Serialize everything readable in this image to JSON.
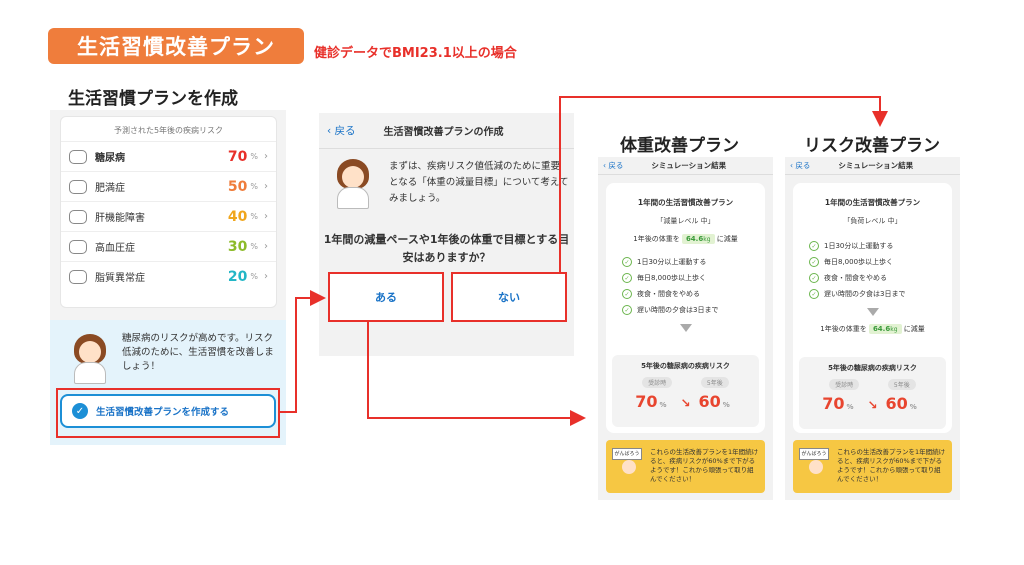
{
  "banner": {
    "title": "生活習慣改善プラン",
    "note": "健診データでBMI23.1以上の場合"
  },
  "panel1": {
    "heading": "生活習慣プランを作成",
    "risk_caption": "予測された5年後の疾病リスク",
    "risks": [
      {
        "name": "糖尿病",
        "value": "70",
        "unit": "%",
        "color": "#e8302a",
        "icon": "hand-icon"
      },
      {
        "name": "肥満症",
        "value": "50",
        "unit": "%",
        "color": "#ef7d3c",
        "icon": "scale-icon"
      },
      {
        "name": "肝機能障害",
        "value": "40",
        "unit": "%",
        "color": "#f0a61e",
        "icon": "liver-icon"
      },
      {
        "name": "高血圧症",
        "value": "30",
        "unit": "%",
        "color": "#8dbb2a",
        "icon": "drop-icon"
      },
      {
        "name": "脂質異常症",
        "value": "20",
        "unit": "%",
        "color": "#23b6c6",
        "icon": "vessel-icon"
      }
    ],
    "message": "糖尿病のリスクが高めです。リスク低減のために、生活習慣を改善しましょう！",
    "create_button": "生活習慣改善プランを作成する"
  },
  "panel2": {
    "back": "戻る",
    "title": "生活習慣改善プランの作成",
    "message": "まずは、疾病リスク値低減のために重要となる「体重の減量目標」について考えてみましょう。",
    "question": "1年間の減量ペースや1年後の体重で目標とする目安はありますか？",
    "yes": "ある",
    "no": "ない"
  },
  "weight_plan": {
    "heading": "体重改善プラン",
    "back": "戻る",
    "header_title": "シミュレーション結果",
    "card_title": "1年間の生活習慣改善プラン",
    "level": "「減量レベル 中」",
    "weight_prefix": "1年後の体重を",
    "weight_value": "64.6",
    "weight_unit": "kg",
    "weight_suffix": "に減量",
    "goals": [
      "1日30分以上運動する",
      "毎日8,000歩以上歩く",
      "夜食・間食をやめる",
      "遅い時間の夕食は3日まで"
    ],
    "risk_title": "5年後の糖尿病の疾病リスク",
    "tag_before": "受診時",
    "tag_after": "5年後",
    "before": "70",
    "after": "60",
    "unit": "%",
    "encourage": "これらの生活改善プランを1年間続けると、疾病リスクが60%まで下がるようです！これから頑張って取り組んでください！",
    "flag_text": "がんばろう"
  },
  "risk_plan": {
    "heading": "リスク改善プラン",
    "back": "戻る",
    "header_title": "シミュレーション結果",
    "card_title": "1年間の生活習慣改善プラン",
    "level": "「負荷レベル 中」",
    "goals": [
      "1日30分以上運動する",
      "毎日8,000歩以上歩く",
      "夜食・間食をやめる",
      "遅い時間の夕食は3日まで"
    ],
    "weight_prefix": "1年後の体重を",
    "weight_value": "64.6",
    "weight_unit": "kg",
    "weight_suffix": "に減量",
    "risk_title": "5年後の糖尿病の疾病リスク",
    "tag_before": "受診時",
    "tag_after": "5年後",
    "before": "70",
    "after": "60",
    "unit": "%",
    "encourage": "これらの生活改善プランを1年間続けると、疾病リスクが60%まで下がるようです！これから頑張って取り組んでください！",
    "flag_text": "がんばろう"
  },
  "colors": {
    "accent_orange": "#ef7d3c",
    "highlight_red": "#e8302a",
    "link_blue": "#1a73c7"
  }
}
